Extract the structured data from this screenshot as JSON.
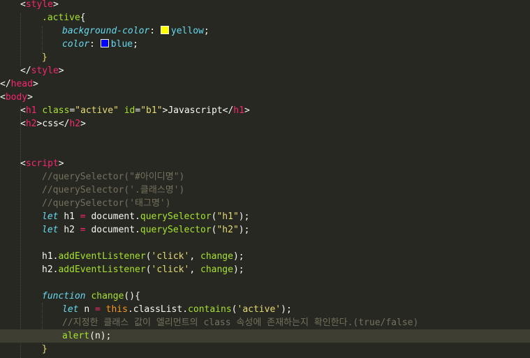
{
  "colors": {
    "background": "#272822",
    "current_line": "#3e3d32",
    "tag": "#f92672",
    "attribute": "#a6e22e",
    "string": "#e6db74",
    "keyword": "#66d9ef",
    "comment": "#75715e",
    "parameter": "#fd971f",
    "swatch_yellow": "#ffff00",
    "swatch_blue": "#0000ff"
  },
  "code": {
    "l01": {
      "open": "<",
      "tag": "style",
      "close": ">"
    },
    "l02": {
      "selector": ".active",
      "brace": "{"
    },
    "l03": {
      "prop": "background-color",
      "colon": ":",
      "value": "yellow",
      "semi": ";"
    },
    "l04": {
      "prop": "color",
      "colon": ":",
      "value": "blue",
      "semi": ";"
    },
    "l05": {
      "brace": "}"
    },
    "l06": {
      "open": "</",
      "tag": "style",
      "close": ">"
    },
    "l07": {
      "open": "</",
      "tag": "head",
      "close": ">"
    },
    "l08": {
      "open": "<",
      "tag": "body",
      "close": ">"
    },
    "l09": {
      "open": "<",
      "tag": "h1",
      "attr1": "class",
      "eq1": "=",
      "val1": "\"active\"",
      "attr2": "id",
      "eq2": "=",
      "val2": "\"b1\"",
      "gt": ">",
      "text": "Javascript",
      "close_open": "</",
      "close_tag": "h1",
      "close_gt": ">"
    },
    "l10": {
      "open": "<",
      "tag": "h2",
      "gt": ">",
      "text": "css",
      "close_open": "</",
      "close_tag": "h2",
      "close_gt": ">"
    },
    "l13": {
      "open": "<",
      "tag": "script",
      "close": ">"
    },
    "l14": {
      "comment": "//querySelector(\"#아이디명\")"
    },
    "l15": {
      "comment": "//querySelector('.클래스명')"
    },
    "l16": {
      "comment": "//querySelector('태그명')"
    },
    "l17": {
      "kw": "let",
      "name": "h1",
      "eq": "=",
      "obj": "document",
      "dot": ".",
      "fn": "querySelector",
      "lp": "(",
      "str": "\"h1\"",
      "rp": ");"
    },
    "l18": {
      "kw": "let",
      "name": "h2",
      "eq": "=",
      "obj": "document",
      "dot": ".",
      "fn": "querySelector",
      "lp": "(",
      "str": "\"h2\"",
      "rp": ");"
    },
    "l20": {
      "obj": "h1",
      "dot": ".",
      "fn": "addEventListener",
      "lp": "(",
      "str": "'click'",
      "comma": ",",
      "arg": "change",
      "rp": ");"
    },
    "l21": {
      "obj": "h2",
      "dot": ".",
      "fn": "addEventListener",
      "lp": "(",
      "str": "'click'",
      "comma": ",",
      "arg": "change",
      "rp": ");"
    },
    "l23": {
      "kw": "function",
      "name": "change",
      "parens": "()",
      "brace": "{"
    },
    "l24": {
      "kw": "let",
      "name": "n",
      "eq": "=",
      "this": "this",
      "dot1": ".",
      "prop": "classList",
      "dot2": ".",
      "fn": "contains",
      "lp": "(",
      "str": "'active'",
      "rp": ");"
    },
    "l25": {
      "comment": "//지정한 클래스 값이 엘리먼트의 class 속성에 존재하는지 확인한다.(true/false)"
    },
    "l26": {
      "fn": "alert",
      "lp": "(",
      "arg": "n",
      "rp": ");"
    },
    "l27": {
      "brace": "}"
    }
  }
}
